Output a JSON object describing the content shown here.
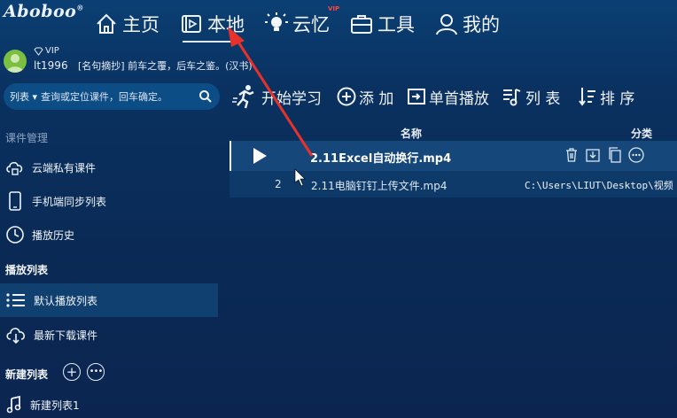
{
  "app": {
    "logo": "Aboboo",
    "logo_mark": "®"
  },
  "nav": [
    {
      "label": "主页",
      "icon": "home-icon"
    },
    {
      "label": "本地",
      "icon": "local-video-icon",
      "active": true
    },
    {
      "label": "云忆",
      "icon": "bulb-icon",
      "badge": "VIP"
    },
    {
      "label": "工具",
      "icon": "toolbox-icon"
    },
    {
      "label": "我的",
      "icon": "user-icon"
    }
  ],
  "user": {
    "vip": "VIP",
    "name": "lt1996",
    "quote": "[名句摘抄] 前车之覆，后车之鉴。(汉书)"
  },
  "search": {
    "scope": "列表",
    "placeholder": "查询或定位课件，回车确定。"
  },
  "toolbar": {
    "start": "开始学习",
    "add": "添 加",
    "single": "单首播放",
    "list": "列 表",
    "sort": "排 序"
  },
  "sidebar": {
    "section_courseware": "课件管理",
    "cloud": "云端私有课件",
    "phone": "手机端同步列表",
    "history": "播放历史",
    "section_playlist": "播放列表",
    "default_list": "默认播放列表",
    "recent": "最新下载课件",
    "section_new": "新建列表",
    "new_list_1": "新建列表1"
  },
  "table": {
    "col_name": "名称",
    "col_category": "分类",
    "rows": [
      {
        "num": "",
        "name": "2.11Excel自动换行.mp4",
        "path": ""
      },
      {
        "num": "2",
        "name": "2.11电脑钉钉上传文件.mp4",
        "path": "C:\\Users\\LIUT\\Desktop\\视频"
      }
    ]
  },
  "colors": {
    "accent": "#e8312b",
    "bg": "#0a2a55",
    "selected": "#10406f"
  }
}
